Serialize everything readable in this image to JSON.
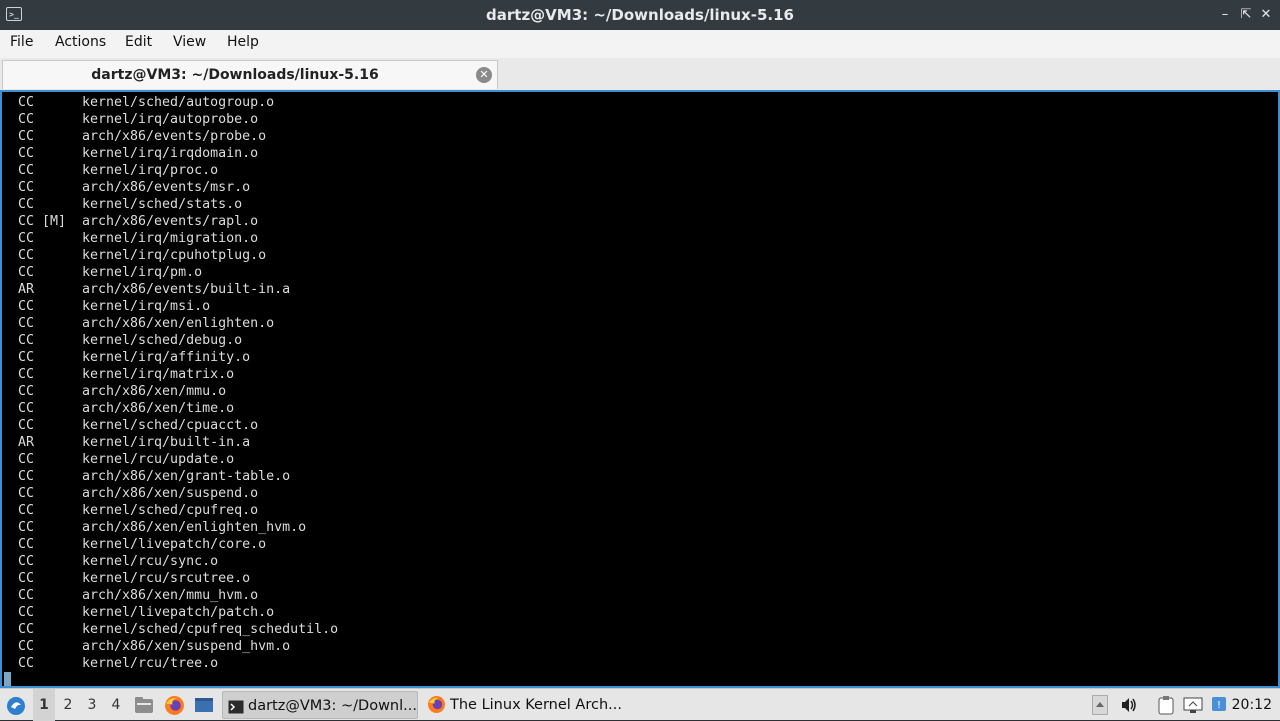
{
  "window": {
    "title": "dartz@VM3: ~/Downloads/linux-5.16",
    "minimize_icon": "minimize-icon",
    "maximize_icon": "maximize-icon",
    "close_icon": "close-icon"
  },
  "menubar": {
    "items": [
      "File",
      "Actions",
      "Edit",
      "View",
      "Help"
    ]
  },
  "tabs": [
    {
      "label": "dartz@VM3: ~/Downloads/linux-5.16",
      "active": true
    }
  ],
  "terminal": {
    "lines": [
      {
        "tag": "CC",
        "path": "kernel/sched/autogroup.o"
      },
      {
        "tag": "CC",
        "path": "kernel/irq/autoprobe.o"
      },
      {
        "tag": "CC",
        "path": "arch/x86/events/probe.o"
      },
      {
        "tag": "CC",
        "path": "kernel/irq/irqdomain.o"
      },
      {
        "tag": "CC",
        "path": "kernel/irq/proc.o"
      },
      {
        "tag": "CC",
        "path": "arch/x86/events/msr.o"
      },
      {
        "tag": "CC",
        "path": "kernel/sched/stats.o"
      },
      {
        "tag": "CC [M]",
        "path": "arch/x86/events/rapl.o"
      },
      {
        "tag": "CC",
        "path": "kernel/irq/migration.o"
      },
      {
        "tag": "CC",
        "path": "kernel/irq/cpuhotplug.o"
      },
      {
        "tag": "CC",
        "path": "kernel/irq/pm.o"
      },
      {
        "tag": "AR",
        "path": "arch/x86/events/built-in.a"
      },
      {
        "tag": "CC",
        "path": "kernel/irq/msi.o"
      },
      {
        "tag": "CC",
        "path": "arch/x86/xen/enlighten.o"
      },
      {
        "tag": "CC",
        "path": "kernel/sched/debug.o"
      },
      {
        "tag": "CC",
        "path": "kernel/irq/affinity.o"
      },
      {
        "tag": "CC",
        "path": "kernel/irq/matrix.o"
      },
      {
        "tag": "CC",
        "path": "arch/x86/xen/mmu.o"
      },
      {
        "tag": "CC",
        "path": "arch/x86/xen/time.o"
      },
      {
        "tag": "CC",
        "path": "kernel/sched/cpuacct.o"
      },
      {
        "tag": "AR",
        "path": "kernel/irq/built-in.a"
      },
      {
        "tag": "CC",
        "path": "kernel/rcu/update.o"
      },
      {
        "tag": "CC",
        "path": "arch/x86/xen/grant-table.o"
      },
      {
        "tag": "CC",
        "path": "arch/x86/xen/suspend.o"
      },
      {
        "tag": "CC",
        "path": "kernel/sched/cpufreq.o"
      },
      {
        "tag": "CC",
        "path": "arch/x86/xen/enlighten_hvm.o"
      },
      {
        "tag": "CC",
        "path": "kernel/livepatch/core.o"
      },
      {
        "tag": "CC",
        "path": "kernel/rcu/sync.o"
      },
      {
        "tag": "CC",
        "path": "kernel/rcu/srcutree.o"
      },
      {
        "tag": "CC",
        "path": "arch/x86/xen/mmu_hvm.o"
      },
      {
        "tag": "CC",
        "path": "kernel/livepatch/patch.o"
      },
      {
        "tag": "CC",
        "path": "kernel/sched/cpufreq_schedutil.o"
      },
      {
        "tag": "CC",
        "path": "arch/x86/xen/suspend_hvm.o"
      },
      {
        "tag": "CC",
        "path": "kernel/rcu/tree.o"
      }
    ]
  },
  "taskbar": {
    "start_icon": "start-menu-icon",
    "workspaces": [
      "1",
      "2",
      "3",
      "4"
    ],
    "active_workspace": "1",
    "launchers": [
      "file-manager-icon",
      "firefox-icon",
      "show-desktop-icon"
    ],
    "tasks": [
      {
        "label": "dartz@VM3: ~/Downl...",
        "icon": "terminal-icon",
        "active": true
      },
      {
        "label": "The Linux Kernel Arch...",
        "icon": "firefox-icon",
        "active": false
      }
    ],
    "tray_icons": [
      "tray-up-icon",
      "volume-icon",
      "clipboard-icon",
      "network-icon",
      "update-icon"
    ],
    "clock": "20:12"
  },
  "colors": {
    "terminal_bg": "#000000",
    "terminal_fg": "#dcdcdc",
    "focus_border": "#3d8fd1",
    "titlebar_bg": "#333a40"
  }
}
